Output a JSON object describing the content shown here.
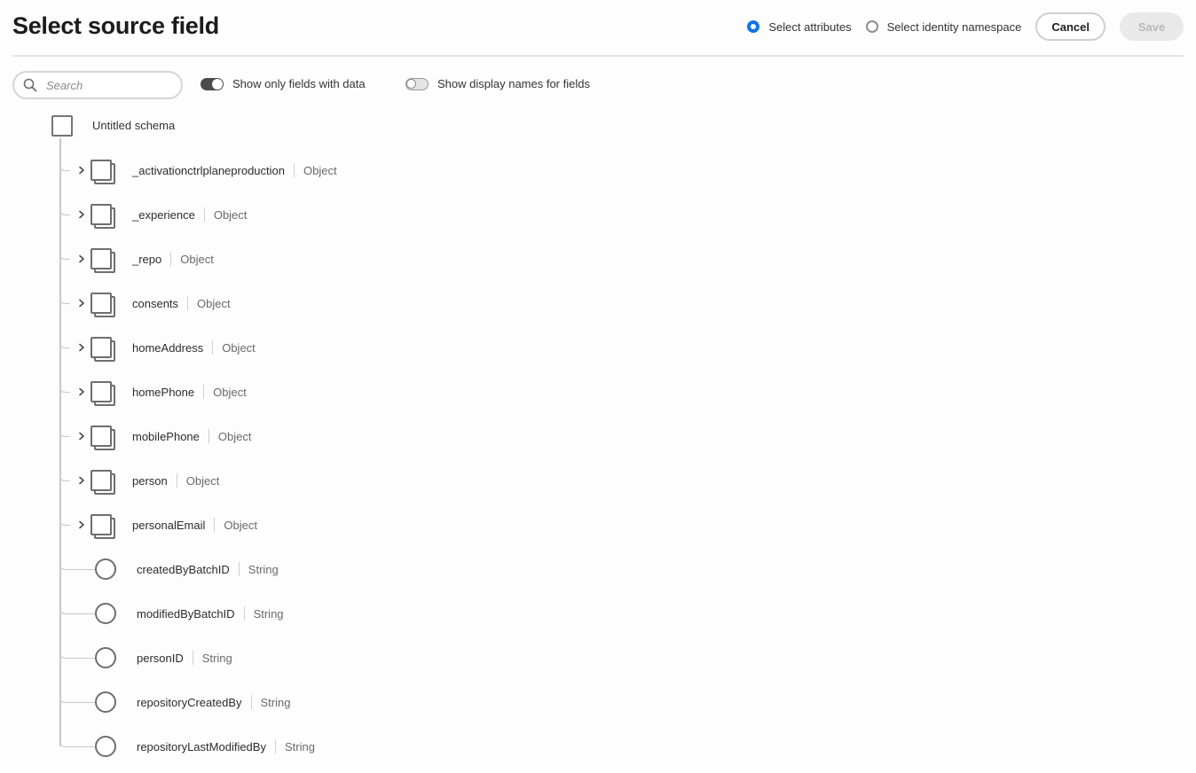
{
  "header": {
    "title": "Select source field",
    "radio_attributes": "Select attributes",
    "radio_identity": "Select identity namespace",
    "cancel_label": "Cancel",
    "save_label": "Save",
    "accent_color": "#1473e6"
  },
  "toolbar": {
    "search_placeholder": "Search",
    "toggle_with_data": {
      "label": "Show only fields with data",
      "on": true
    },
    "toggle_display_names": {
      "label": "Show display names for fields",
      "on": false
    }
  },
  "tree": {
    "root_label": "Untitled schema",
    "nodes": [
      {
        "name": "_activationctrlplaneproduction",
        "type": "Object"
      },
      {
        "name": "_experience",
        "type": "Object"
      },
      {
        "name": "_repo",
        "type": "Object"
      },
      {
        "name": "consents",
        "type": "Object"
      },
      {
        "name": "homeAddress",
        "type": "Object"
      },
      {
        "name": "homePhone",
        "type": "Object"
      },
      {
        "name": "mobilePhone",
        "type": "Object"
      },
      {
        "name": "person",
        "type": "Object"
      },
      {
        "name": "personalEmail",
        "type": "Object"
      },
      {
        "name": "createdByBatchID",
        "type": "String"
      },
      {
        "name": "modifiedByBatchID",
        "type": "String"
      },
      {
        "name": "personID",
        "type": "String"
      },
      {
        "name": "repositoryCreatedBy",
        "type": "String"
      },
      {
        "name": "repositoryLastModifiedBy",
        "type": "String"
      }
    ]
  }
}
